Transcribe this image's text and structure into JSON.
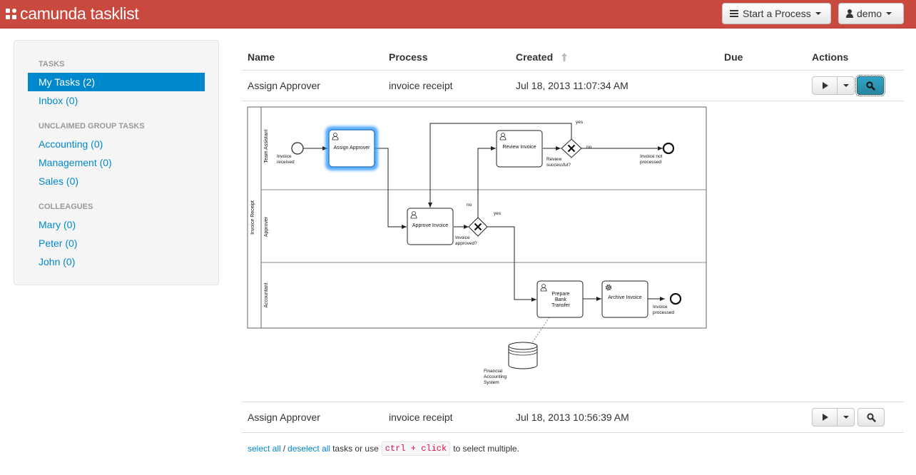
{
  "header": {
    "brand": "camunda tasklist",
    "start_process_label": "Start a Process",
    "user_label": "demo",
    "icons": {
      "start_process": "list-icon",
      "user": "user-icon",
      "caret": "caret-down-icon"
    }
  },
  "sidebar": {
    "tasks_header": "TASKS",
    "my_tasks": "My Tasks (2)",
    "inbox": "Inbox (0)",
    "group_header": "UNCLAIMED GROUP TASKS",
    "groups": [
      "Accounting (0)",
      "Management (0)",
      "Sales (0)"
    ],
    "colleagues_header": "COLLEAGUES",
    "colleagues": [
      "Mary (0)",
      "Peter (0)",
      "John (0)"
    ]
  },
  "table": {
    "headers": {
      "name": "Name",
      "process": "Process",
      "created": "Created",
      "due": "Due",
      "actions": "Actions"
    },
    "sorted_by": "Created",
    "sort_direction": "ascending",
    "rows": [
      {
        "name": "Assign Approver",
        "process": "invoice receipt",
        "created": "Jul 18, 2013 11:07:34 AM",
        "due": "",
        "selected": true
      },
      {
        "name": "Assign Approver",
        "process": "invoice receipt",
        "created": "Jul 18, 2013 10:56:39 AM",
        "due": "",
        "selected": false
      }
    ]
  },
  "diagram": {
    "pool": "Invoice Receipt",
    "lanes": [
      "Team Assistant",
      "Approver",
      "Accountant"
    ],
    "start_event": "Invoice received",
    "tasks": {
      "assign": "Assign Approver",
      "review": "Review Invoice",
      "approve": "Approve Invoice",
      "prepare_1": "Prepare",
      "prepare_2": "Bank",
      "prepare_3": "Transfer",
      "archive": "Archive Invoice"
    },
    "gateways": {
      "review_1": "Review",
      "review_2": "successful?",
      "approved_1": "Invoice",
      "approved_2": "approved?"
    },
    "flow_labels": {
      "yes": "yes",
      "no": "no"
    },
    "end_events": {
      "not_processed_1": "Invoice not",
      "not_processed_2": "processed",
      "processed_1": "Invoice",
      "processed_2": "processed"
    },
    "start_label_1": "Invoice",
    "start_label_2": "received",
    "datastore_1": "Financial",
    "datastore_2": "Accounting",
    "datastore_3": "System",
    "highlighted_task": "Assign Approver"
  },
  "footer": {
    "select_all": "select all",
    "separator": "/",
    "deselect_all": "deselect all",
    "middle": "tasks or use",
    "shortcut": "ctrl + click",
    "end": "to select multiple."
  },
  "colors": {
    "header": "#c9493f",
    "link": "#0088cc",
    "active_search_button": "#2f96b4",
    "highlight_glow": "#3399ff"
  }
}
